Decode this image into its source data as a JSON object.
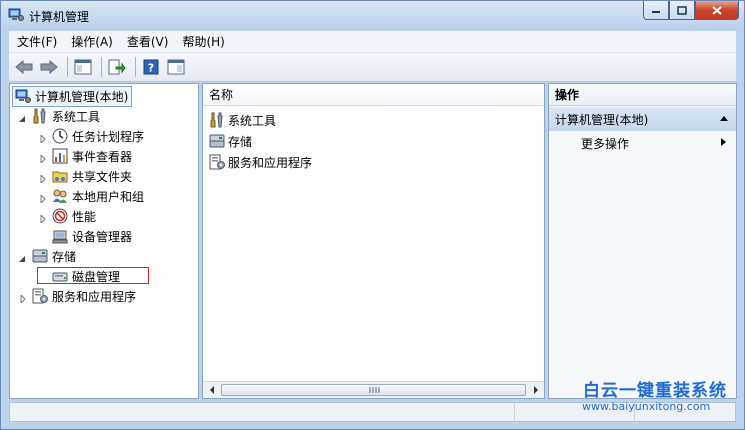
{
  "window": {
    "title": "计算机管理",
    "controls": [
      "minimize",
      "maximize",
      "close"
    ]
  },
  "menu": [
    "文件(F)",
    "操作(A)",
    "查看(V)",
    "帮助(H)"
  ],
  "toolbar": [
    "back-arrow-icon",
    "forward-arrow-icon",
    "show-hide-tree-icon",
    "export-list-icon",
    "help-icon",
    "action-pane-icon"
  ],
  "tree": {
    "root": "计算机管理(本地)",
    "system_tools": "系统工具",
    "task_scheduler": "任务计划程序",
    "event_viewer": "事件查看器",
    "shared_folders": "共享文件夹",
    "local_users": "本地用户和组",
    "performance": "性能",
    "device_manager": "设备管理器",
    "storage": "存储",
    "disk_management": "磁盘管理",
    "services_apps": "服务和应用程序"
  },
  "middle": {
    "column_header": "名称",
    "items": [
      "系统工具",
      "存储",
      "服务和应用程序"
    ]
  },
  "actions": {
    "header": "操作",
    "group": "计算机管理(本地)",
    "more": "更多操作"
  },
  "watermark": {
    "title": "白云一键重装系统",
    "url": "www.baiyunxitong.com"
  },
  "colors": {
    "title_bar": "#c4d8ef",
    "action_group": "#c5d7ec",
    "highlight_box": "#e02020",
    "watermark": "#1f6bd4"
  }
}
